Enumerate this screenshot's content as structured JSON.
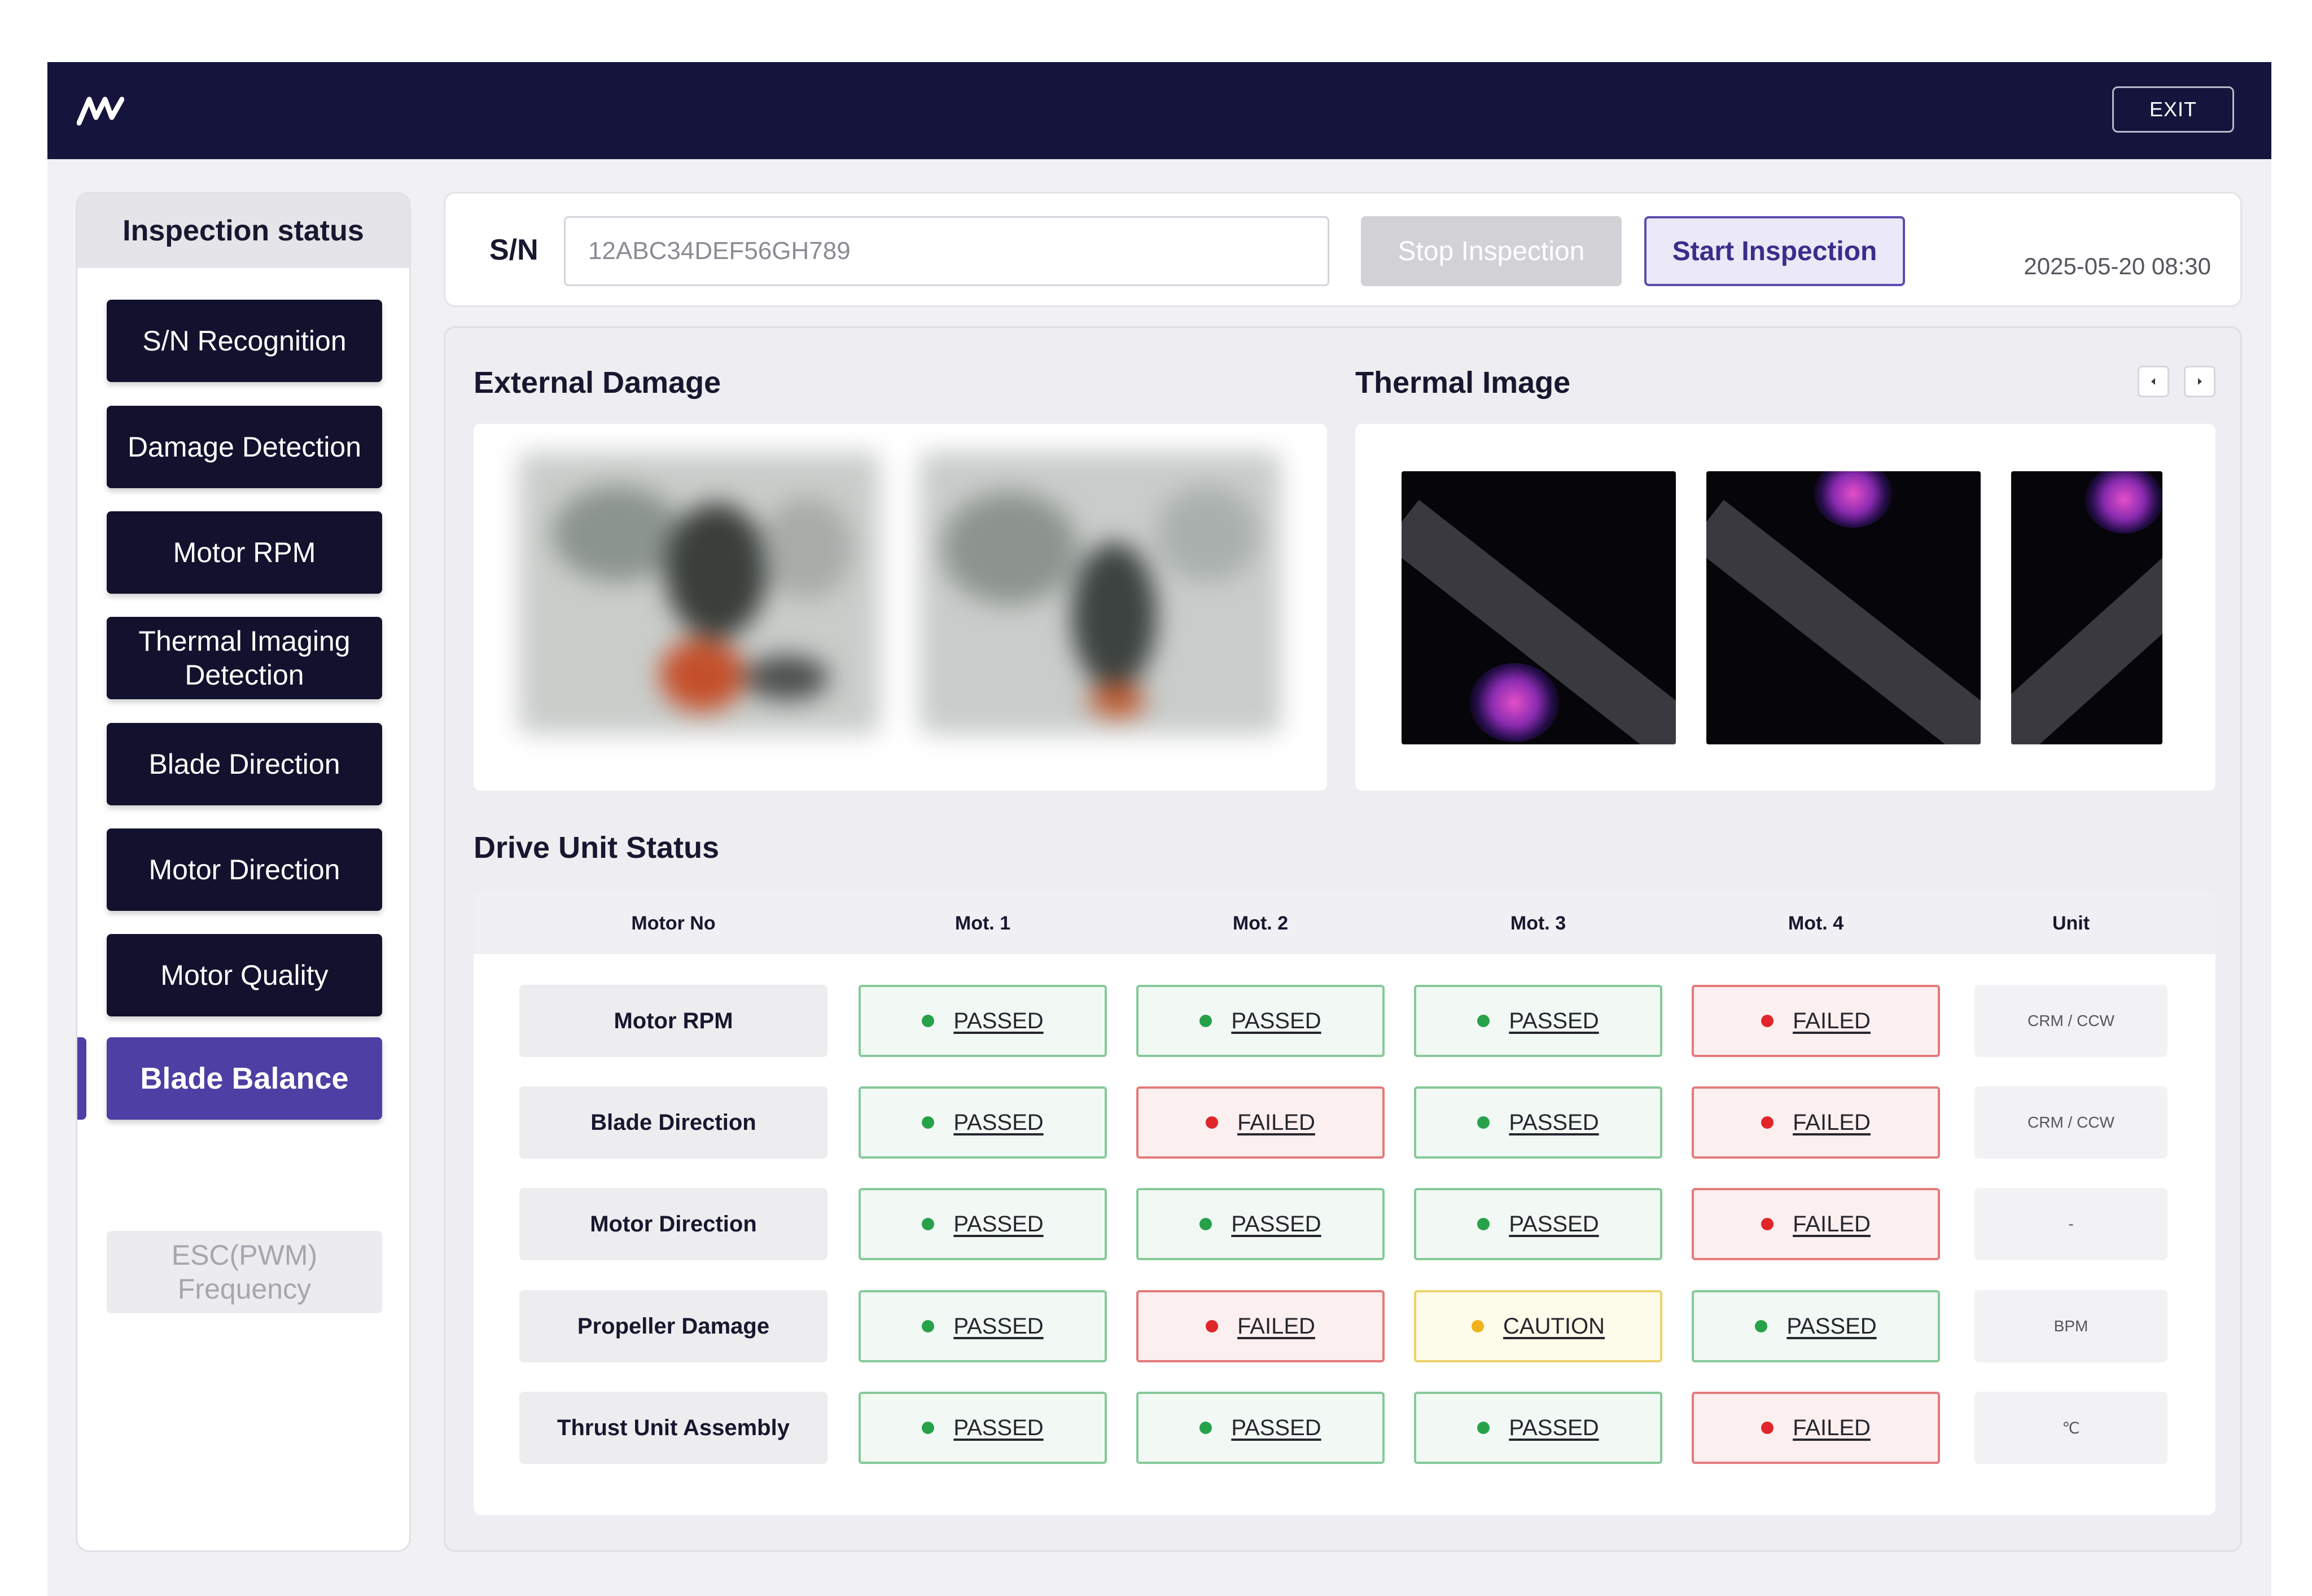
{
  "header": {
    "logo_icon": "wave-logo-icon",
    "exit_label": "EXIT"
  },
  "sidebar": {
    "title": "Inspection status",
    "steps": [
      {
        "label": "S/N Recognition",
        "state": "done"
      },
      {
        "label": "Damage Detection",
        "state": "done"
      },
      {
        "label": "Motor RPM",
        "state": "done"
      },
      {
        "label": "Thermal Imaging Detection",
        "state": "done"
      },
      {
        "label": "Blade Direction",
        "state": "done"
      },
      {
        "label": "Motor Direction",
        "state": "done"
      },
      {
        "label": "Motor Quality",
        "state": "done"
      },
      {
        "label": "Blade Balance",
        "state": "active"
      },
      {
        "label": "ESC(PWM) Frequency",
        "state": "pending"
      }
    ]
  },
  "inspection": {
    "sn_label": "S/N",
    "sn_value": "12ABC34DEF56GH789",
    "stop_label": "Stop Inspection",
    "start_label": "Start Inspection",
    "datetime": "2025-05-20 08:30"
  },
  "sections": {
    "external_damage": "External Damage",
    "thermal_image": "Thermal Image",
    "drive_unit_status": "Drive Unit Status"
  },
  "table": {
    "headers": [
      "Motor No",
      "Mot. 1",
      "Mot. 2",
      "Mot. 3",
      "Mot. 4",
      "Unit"
    ],
    "rows": [
      {
        "label": "Motor RPM",
        "statuses": [
          "PASSED",
          "PASSED",
          "PASSED",
          "FAILED"
        ],
        "unit": "CRM / CCW"
      },
      {
        "label": "Blade Direction",
        "statuses": [
          "PASSED",
          "FAILED",
          "PASSED",
          "FAILED"
        ],
        "unit": "CRM / CCW"
      },
      {
        "label": "Motor Direction",
        "statuses": [
          "PASSED",
          "PASSED",
          "PASSED",
          "FAILED"
        ],
        "unit": "-"
      },
      {
        "label": "Propeller Damage",
        "statuses": [
          "PASSED",
          "FAILED",
          "CAUTION",
          "PASSED"
        ],
        "unit": "BPM"
      },
      {
        "label": "Thrust Unit Assembly",
        "statuses": [
          "PASSED",
          "PASSED",
          "PASSED",
          "FAILED"
        ],
        "unit": "℃"
      }
    ]
  },
  "colors": {
    "navy": "#14143c",
    "accent": "#4d3fa3",
    "passed": "#27a24a",
    "failed": "#e0262a",
    "caution": "#f0b21b"
  }
}
